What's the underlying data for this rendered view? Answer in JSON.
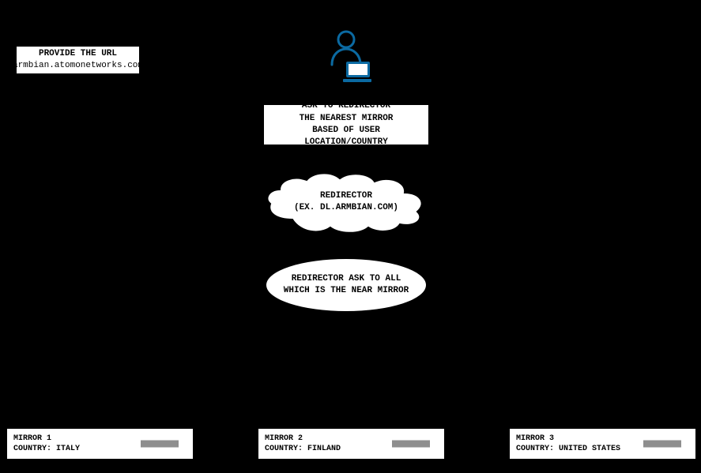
{
  "provide_url": {
    "line1": "PROVIDE THE URL",
    "line2": "armbian.atomonetworks.com"
  },
  "ask_redirector": {
    "line1": "ASK TO REDIRECTOR",
    "line2": "THE NEAREST MIRROR",
    "line3": "BASED OF USER LOCATION/COUNTRY"
  },
  "redirector": {
    "line1": "REDIRECTOR",
    "line2": "(EX. DL.ARMBIAN.COM)"
  },
  "ask_all": {
    "line1": "REDIRECTOR ASK TO ALL",
    "line2": "WHICH IS THE NEAR MIRROR"
  },
  "mirrors": {
    "m1": {
      "name": "MIRROR 1",
      "country_label": "COUNTRY:",
      "country": "ITALY"
    },
    "m2": {
      "name": "MIRROR 2",
      "country_label": "COUNTRY:",
      "country": "FINLAND"
    },
    "m3": {
      "name": "MIRROR 3",
      "country_label": "COUNTRY:",
      "country": "UNITED STATES"
    }
  },
  "colors": {
    "accent": "#0b6aa2"
  }
}
